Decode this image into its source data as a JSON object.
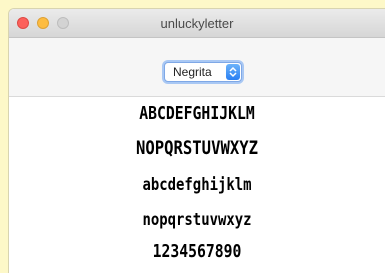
{
  "window": {
    "title": "unluckyletter"
  },
  "toolbar": {
    "font_select": {
      "value": "Negrita"
    }
  },
  "preview": {
    "uppercase_1": "ABCDEFGHIJKLM",
    "uppercase_2": "NOPQRSTUVWXYZ",
    "lowercase_1": "abcdefghijklm",
    "lowercase_2": "nopqrstuvwxyz",
    "digits": "1234567890"
  },
  "colors": {
    "background": "#fdf8c8",
    "accent": "#2a7ff3",
    "close": "#fc605b",
    "minimize": "#fdbc40"
  },
  "icons": {
    "close": "close-dot-icon",
    "minimize": "minimize-dot-icon",
    "maximize": "maximize-dot-icon",
    "select_arrows": "updown-chevron-icon"
  }
}
